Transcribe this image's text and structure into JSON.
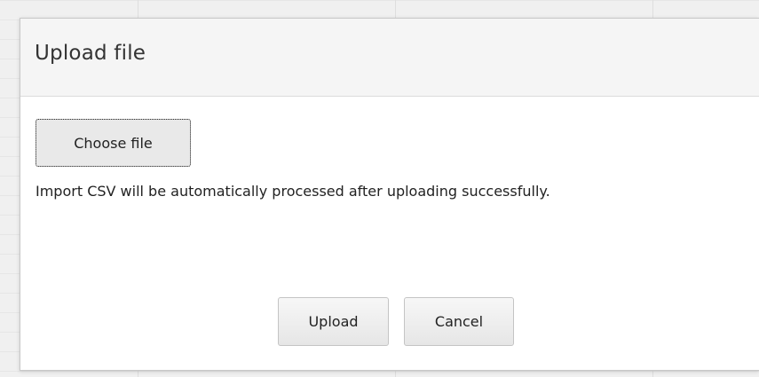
{
  "dialog": {
    "title": "Upload file",
    "choose_file_label": "Choose file",
    "help_text": "Import CSV will be automatically processed after uploading successfully.",
    "upload_label": "Upload",
    "cancel_label": "Cancel"
  }
}
